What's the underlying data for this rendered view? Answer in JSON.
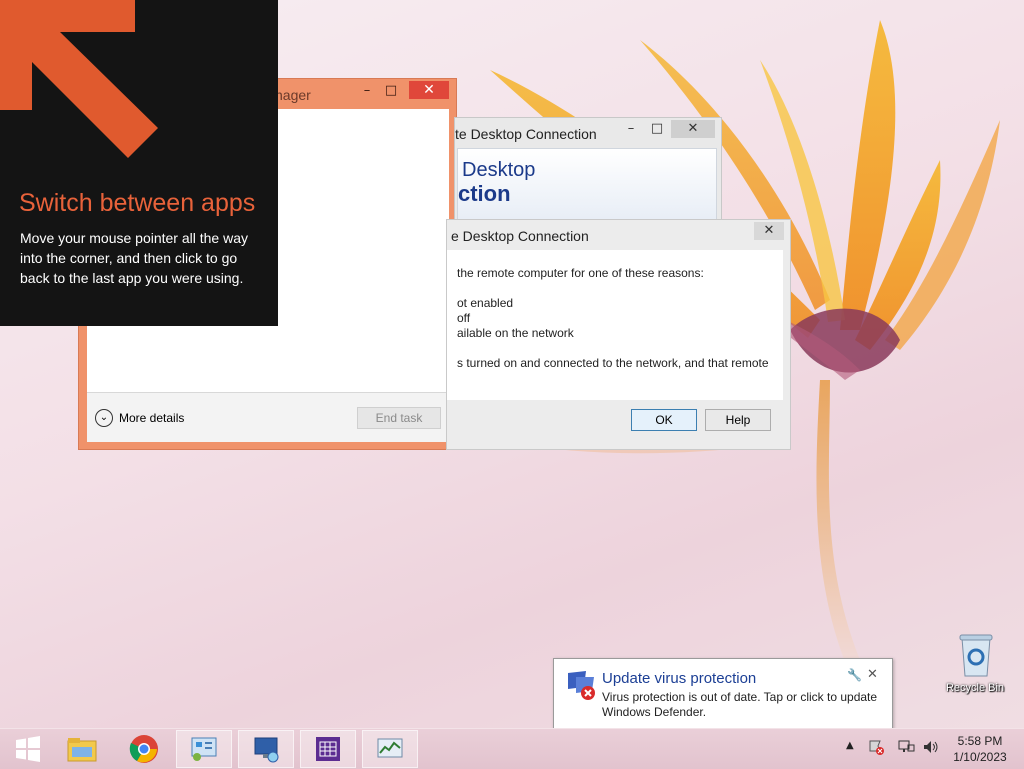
{
  "tip": {
    "heading": "Switch between apps",
    "body": "Move your mouse pointer all the way into the corner, and then click to go back to the last app you were using."
  },
  "task_manager": {
    "title_visible": "nager",
    "more_details": "More details",
    "end_task": "End task"
  },
  "rdc_back": {
    "title_visible": "te Desktop Connection",
    "banner_line1": "Desktop",
    "banner_line2": "ction"
  },
  "rdc_error": {
    "title_visible": "e Desktop Connection",
    "lines": [
      "the remote computer for one of these reasons:",
      "ot enabled",
      " off",
      "ailable on the network",
      "s turned on and connected to the network, and that remote"
    ],
    "ok": "OK",
    "help": "Help"
  },
  "notification": {
    "title": "Update virus protection",
    "body": "Virus protection is out of date. Tap or click to update Windows Defender."
  },
  "desktop": {
    "recycle_bin": "Recycle Bin"
  },
  "taskbar": {
    "time": "5:58 PM",
    "date": "1/10/2023",
    "apps": [
      "file-explorer-icon",
      "chrome-icon",
      "control-panel-icon",
      "remote-desktop-icon",
      "calendar-app-icon",
      "task-manager-icon"
    ]
  },
  "colors": {
    "accent_orange": "#e8623a",
    "tip_bg": "#141414",
    "task_manager_frame": "#f0926a",
    "close_red": "#e0473a"
  }
}
